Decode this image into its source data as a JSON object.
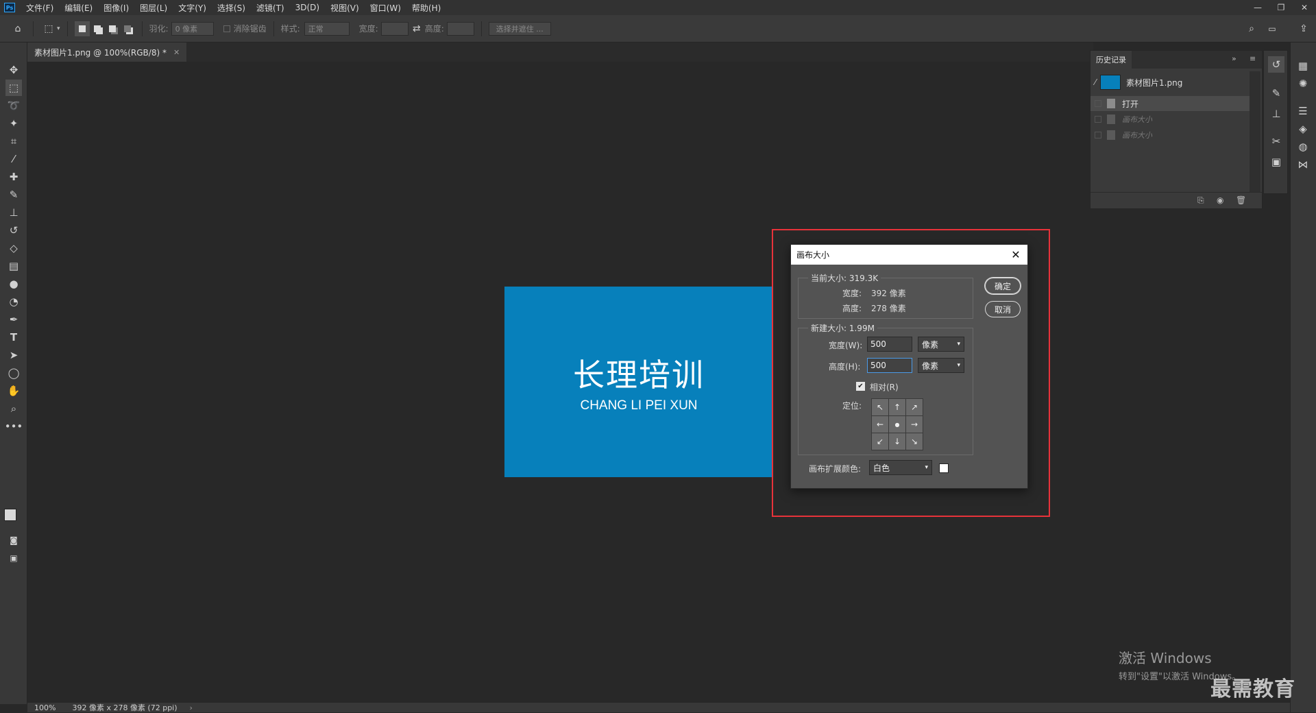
{
  "menu": {
    "logo": "Ps",
    "items": [
      "文件(F)",
      "编辑(E)",
      "图像(I)",
      "图层(L)",
      "文字(Y)",
      "选择(S)",
      "滤镜(T)",
      "3D(D)",
      "视图(V)",
      "窗口(W)",
      "帮助(H)"
    ]
  },
  "options": {
    "feather_label": "羽化:",
    "feather_value": "0 像素",
    "antialias_label": "消除锯齿",
    "style_label": "样式:",
    "style_value": "正常",
    "width_label": "宽度:",
    "height_label": "高度:",
    "select_mask_button": "选择并遮住 ..."
  },
  "document_tab": {
    "title": "素材图片1.png @ 100%(RGB/8) *"
  },
  "canvas_image": {
    "title": "长理培训",
    "subtitle": "CHANG LI PEI XUN",
    "background_color": "#0780bb"
  },
  "dialog": {
    "title": "画布大小",
    "current_size_label": "当前大小: 319.3K",
    "current_width_label": "宽度:",
    "current_width_value": "392 像素",
    "current_height_label": "高度:",
    "current_height_value": "278 像素",
    "new_size_label": "新建大小: 1.99M",
    "new_width_label": "宽度(W):",
    "new_width_value": "500",
    "new_width_unit": "像素",
    "new_height_label": "高度(H):",
    "new_height_value": "500",
    "new_height_unit": "像素",
    "relative_label": "相对(R)",
    "relative_checked": true,
    "anchor_label": "定位:",
    "anchor_arrows": [
      "↖",
      "↑",
      "↗",
      "←",
      "●",
      "→",
      "↙",
      "↓",
      "↘"
    ],
    "extension_color_label": "画布扩展颜色:",
    "extension_color_value": "白色",
    "ok_button": "确定",
    "cancel_button": "取消",
    "highlight_color": "#e8323a"
  },
  "history": {
    "tab_label": "历史记录",
    "snapshot_label": "素材图片1.png",
    "steps": [
      "打开",
      "画布大小",
      "画布大小"
    ]
  },
  "status": {
    "zoom": "100%",
    "doc_info": "392 像素 x 278 像素 (72 ppi)"
  },
  "watermark": {
    "activate_title": "激活 Windows",
    "activate_sub": "转到\"设置\"以激活 Windows。",
    "brand": "最需教育"
  }
}
